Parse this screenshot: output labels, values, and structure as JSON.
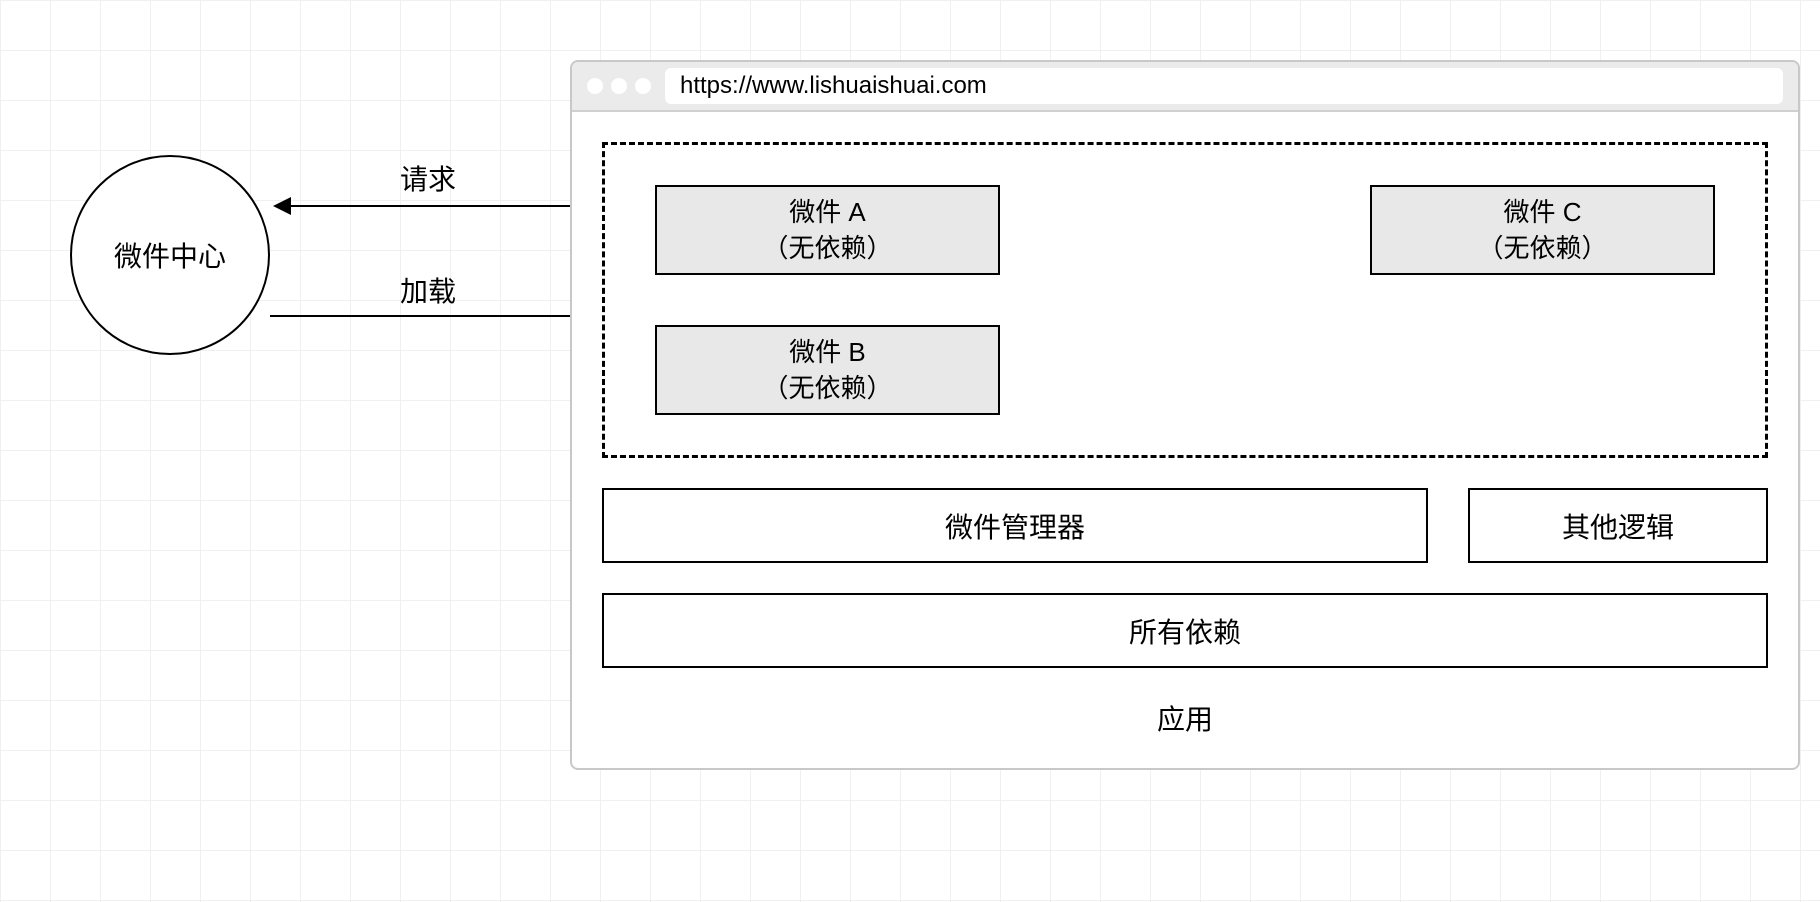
{
  "diagram": {
    "circle_label": "微件中心",
    "arrow_request_label": "请求",
    "arrow_load_label": "加载",
    "browser": {
      "url": "https://www.lishuaishuai.com",
      "widgets": {
        "a": {
          "title": "微件 A",
          "subtitle": "（无依赖）"
        },
        "b": {
          "title": "微件 B",
          "subtitle": "（无依赖）"
        },
        "c": {
          "title": "微件 C",
          "subtitle": "（无依赖）"
        }
      },
      "manager_label": "微件管理器",
      "other_logic_label": "其他逻辑",
      "deps_label": "所有依赖",
      "app_label": "应用"
    }
  }
}
